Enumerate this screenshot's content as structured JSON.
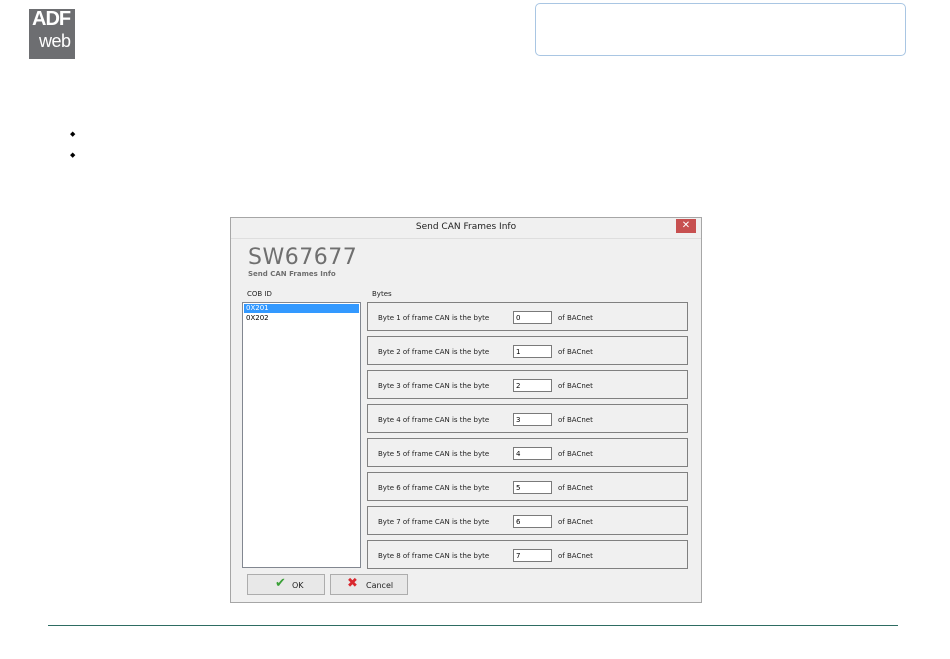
{
  "logo": {
    "line1": "ADF",
    "line2": "web"
  },
  "dialog": {
    "title": "Send CAN Frames Info",
    "close_glyph": "✕",
    "code": "SW67677",
    "subtitle": "Send CAN Frames Info",
    "cob_label": "COB ID",
    "bytes_label": "Bytes",
    "cob_ids": [
      "0X201",
      "0X202"
    ],
    "selected_cob": "0X201",
    "rows": [
      {
        "prefix": "Byte 1 of frame CAN is the byte",
        "value": "0",
        "suffix": "of BACnet"
      },
      {
        "prefix": "Byte 2 of frame CAN is the byte",
        "value": "1",
        "suffix": "of BACnet"
      },
      {
        "prefix": "Byte 3 of frame CAN is the byte",
        "value": "2",
        "suffix": "of BACnet"
      },
      {
        "prefix": "Byte 4 of frame CAN is the byte",
        "value": "3",
        "suffix": "of BACnet"
      },
      {
        "prefix": "Byte 5 of frame CAN is the byte",
        "value": "4",
        "suffix": "of BACnet"
      },
      {
        "prefix": "Byte 6 of frame CAN is the byte",
        "value": "5",
        "suffix": "of BACnet"
      },
      {
        "prefix": "Byte 7 of frame CAN is the byte",
        "value": "6",
        "suffix": "of BACnet"
      },
      {
        "prefix": "Byte 8 of frame CAN is the byte",
        "value": "7",
        "suffix": "of BACnet"
      }
    ],
    "ok_label": "OK",
    "cancel_label": "Cancel",
    "icons": {
      "ok": "check-icon",
      "cancel": "cross-icon"
    },
    "colors": {
      "selection": "#3399ff",
      "close": "#c75050",
      "ok_icon": "#3aa037",
      "cancel_icon": "#d9282f"
    }
  }
}
